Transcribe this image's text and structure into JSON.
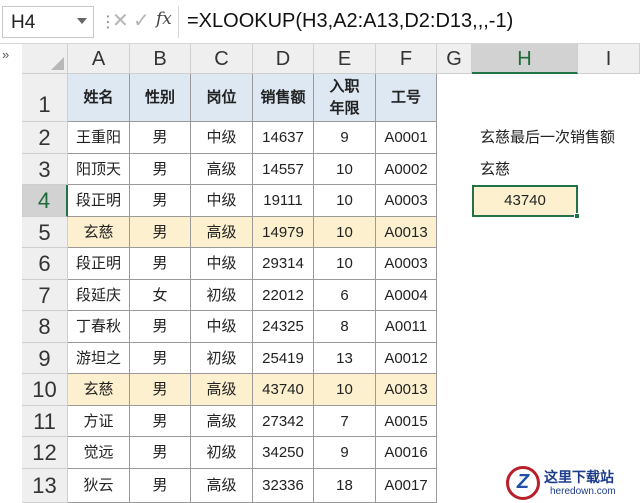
{
  "formula_bar": {
    "name_box": "H4",
    "formula": "=XLOOKUP(H3,A2:A13,D2:D13,,,-1)",
    "icons": [
      "cancel-icon",
      "check-icon",
      "fx-icon"
    ]
  },
  "sheet": {
    "columns": [
      "A",
      "B",
      "C",
      "D",
      "E",
      "F",
      "G",
      "H",
      "I"
    ],
    "selected_column": "H",
    "selected_row": "4",
    "rows": [
      "1",
      "2",
      "3",
      "4",
      "5",
      "6",
      "7",
      "8",
      "9",
      "10",
      "11",
      "12",
      "13"
    ],
    "table": {
      "headers": [
        "姓名",
        "性别",
        "岗位",
        "销售额",
        "入职\n年限",
        "工号"
      ],
      "rows": [
        [
          "王重阳",
          "男",
          "中级",
          "14637",
          "9",
          "A0001"
        ],
        [
          "阳顶天",
          "男",
          "高级",
          "14557",
          "10",
          "A0002"
        ],
        [
          "段正明",
          "男",
          "中级",
          "19111",
          "10",
          "A0003"
        ],
        [
          "玄慈",
          "男",
          "高级",
          "14979",
          "10",
          "A0013"
        ],
        [
          "段正明",
          "男",
          "中级",
          "29314",
          "10",
          "A0003"
        ],
        [
          "段延庆",
          "女",
          "初级",
          "22012",
          "6",
          "A0004"
        ],
        [
          "丁春秋",
          "男",
          "中级",
          "24325",
          "8",
          "A0011"
        ],
        [
          "游坦之",
          "男",
          "初级",
          "25419",
          "13",
          "A0012"
        ],
        [
          "玄慈",
          "男",
          "高级",
          "43740",
          "10",
          "A0013"
        ],
        [
          "方证",
          "男",
          "高级",
          "27342",
          "7",
          "A0015"
        ],
        [
          "觉远",
          "男",
          "初级",
          "34250",
          "9",
          "A0016"
        ],
        [
          "狄云",
          "男",
          "高级",
          "32336",
          "18",
          "A0017"
        ]
      ],
      "highlight_color": "#fcf0cf",
      "header_color": "#dde8f3"
    },
    "side": {
      "H2": "玄慈最后一次销售额",
      "H3": "玄慈",
      "H4": "43740"
    },
    "accent_color": "#217346"
  },
  "watermark": {
    "title": "这里下载站",
    "url": "heredown.com",
    "logo_letter": "Z"
  }
}
